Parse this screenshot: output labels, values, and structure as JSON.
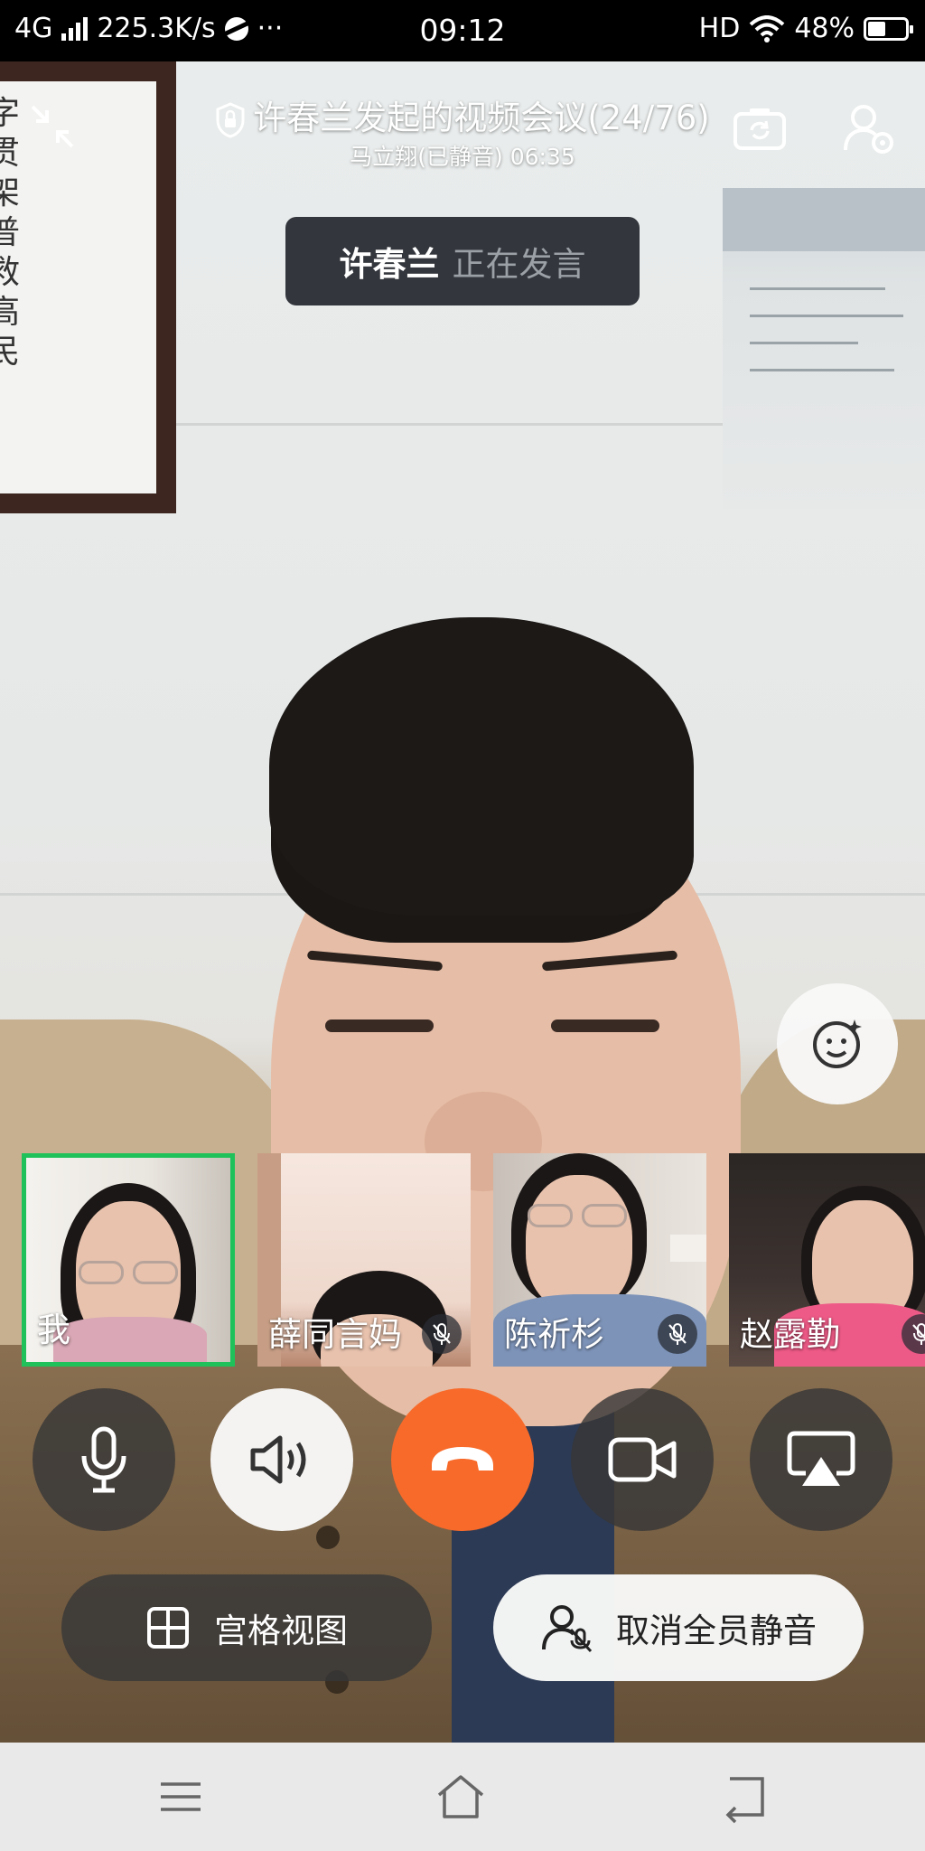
{
  "status_bar": {
    "network": "4G",
    "speed": "225.3K/s",
    "more": "···",
    "time": "09:12",
    "hd": "HD",
    "battery_text": "48%",
    "battery_level": 0.48
  },
  "meeting": {
    "title": "许春兰发起的视频会议(24/76)",
    "subtitle": "马立翔(已静音) 06:35"
  },
  "speaker_toast": {
    "name": "许春兰",
    "state": "正在发言"
  },
  "background_wall_text": "字贯架普救高民",
  "participants": [
    {
      "name": "我",
      "muted": false,
      "active": true
    },
    {
      "name": "薛同言妈",
      "muted": true,
      "active": false
    },
    {
      "name": "陈祈杉",
      "muted": true,
      "active": false
    },
    {
      "name": "赵露勤",
      "muted": true,
      "active": false
    }
  ],
  "controls": {
    "grid_view_label": "宫格视图",
    "unmute_all_label": "取消全员静音"
  },
  "icons": {
    "microphone": "microphone-icon",
    "speaker": "speaker-icon",
    "hangup": "hangup-icon",
    "camera": "camera-icon",
    "screen_share": "screen-share-icon",
    "grid": "grid-icon",
    "mute_all": "mute-all-icon",
    "beauty": "beauty-face-icon"
  },
  "colors": {
    "hangup": "#f86a2a",
    "active_border": "#1fc25a",
    "toast_bg": "#23262d"
  }
}
